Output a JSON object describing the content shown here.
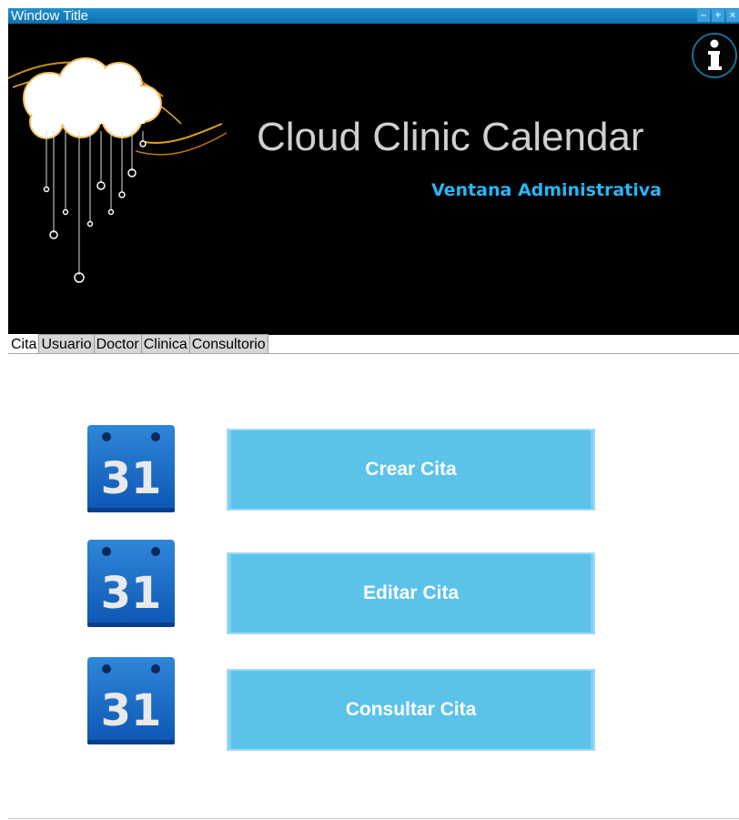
{
  "window": {
    "title": "Window Title",
    "controls": {
      "minimize": "–",
      "maximize": "+",
      "close": "×"
    }
  },
  "banner": {
    "title": "Cloud Clinic Calendar",
    "subtitle": "Ventana Administrativa",
    "info_icon": "info-icon",
    "title_color": "#cfcfcf",
    "subtitle_color": "#29b6f6"
  },
  "tabs": [
    {
      "label": "Cita",
      "active": true
    },
    {
      "label": "Usuario",
      "active": false
    },
    {
      "label": "Doctor",
      "active": false
    },
    {
      "label": "Clinica",
      "active": false
    },
    {
      "label": "Consultorio",
      "active": false
    }
  ],
  "actions": [
    {
      "icon": "calendar-icon",
      "icon_text": "31",
      "label": "Crear Cita"
    },
    {
      "icon": "calendar-icon",
      "icon_text": "31",
      "label": "Editar Cita"
    },
    {
      "icon": "calendar-icon",
      "icon_text": "31",
      "label": "Consultar Cita"
    }
  ],
  "colors": {
    "titlebar": "#1579b9",
    "button_fill": "#5bc2ea",
    "button_text": "#ffffff",
    "calendar_blue": "#1565c0"
  }
}
